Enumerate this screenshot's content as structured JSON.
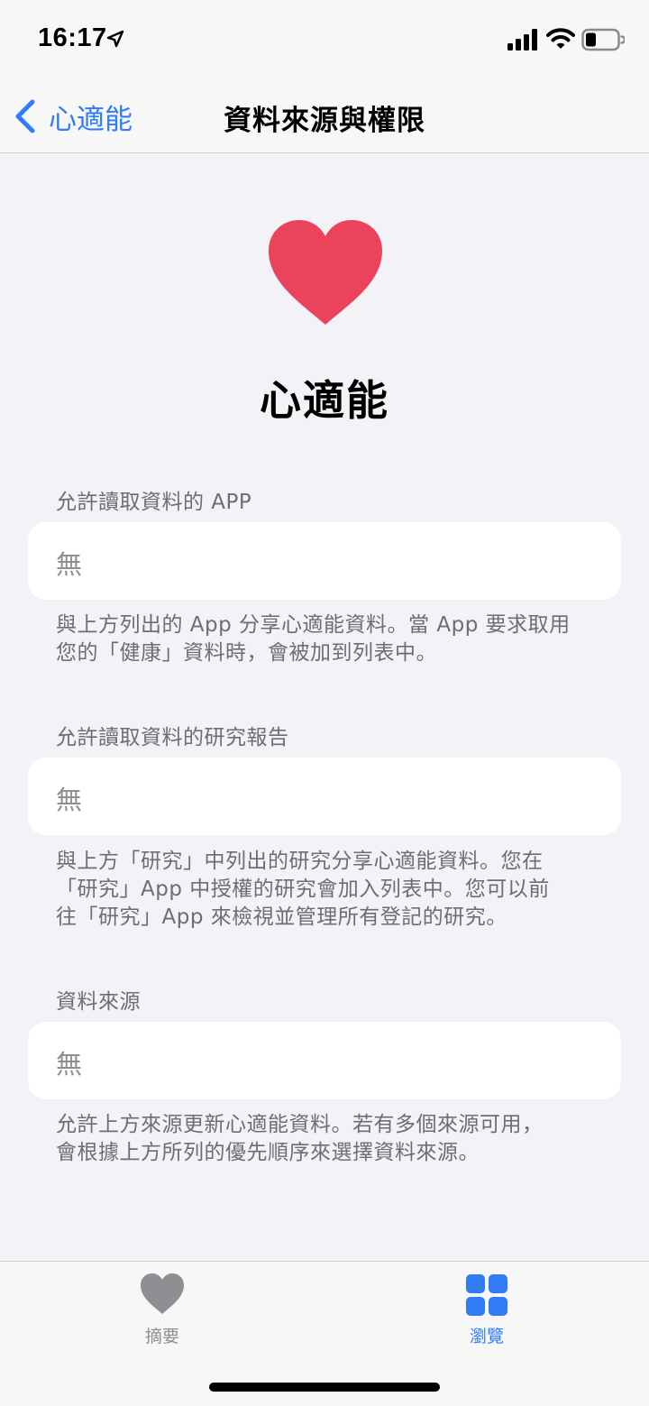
{
  "status_bar": {
    "time": "16:17"
  },
  "nav": {
    "back_label": "心適能",
    "title": "資料來源與權限"
  },
  "hero": {
    "title": "心適能",
    "heart_color": "#ea435b"
  },
  "sections": [
    {
      "header": "允許讀取資料的 APP",
      "value": "無",
      "footnote": "與上方列出的 App 分享心適能資料。當 App 要求取用\n您的「健康」資料時，會被加到列表中。"
    },
    {
      "header": "允許讀取資料的研究報告",
      "value": "無",
      "footnote": "與上方「研究」中列出的研究分享心適能資料。您在\n「研究」App 中授權的研究會加入列表中。您可以前\n往「研究」App 來檢視並管理所有登記的研究。"
    },
    {
      "header": "資料來源",
      "value": "無",
      "footnote": "允許上方來源更新心適能資料。若有多個來源可用，\n會根據上方所列的優先順序來選擇資料來源。"
    }
  ],
  "tab_bar": {
    "summary_label": "摘要",
    "browse_label": "瀏覽",
    "active_tab": "browse",
    "accent_color": "#2f7cf6",
    "inactive_color": "#8e8e93"
  }
}
